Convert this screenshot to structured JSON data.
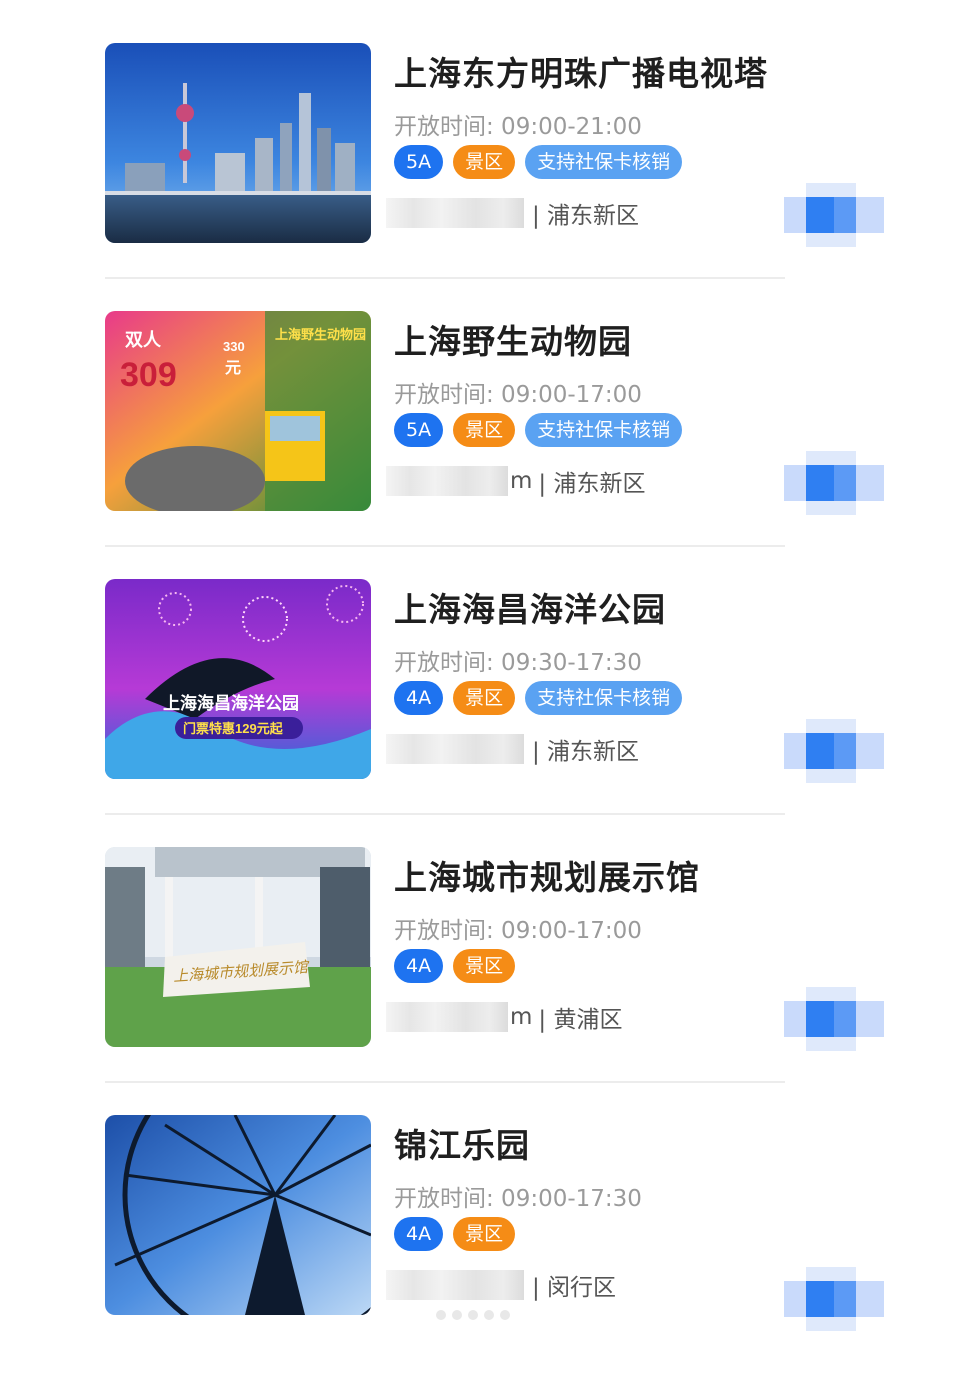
{
  "scenic_list": [
    {
      "name": "上海东方明珠广播电视塔",
      "hours": "开放时间: 09:00-21:00",
      "tags": {
        "level": "5A",
        "type": "景区",
        "social": "支持社保卡核销"
      },
      "distance_suffix": "",
      "district": "| 浦东新区",
      "image": "oriental-pearl-skyline"
    },
    {
      "name": "上海野生动物园",
      "hours": "开放时间: 09:00-17:00",
      "tags": {
        "level": "5A",
        "type": "景区",
        "social": "支持社保卡核销"
      },
      "distance_suffix": "m",
      "district": "| 浦东新区",
      "image": "wildlife-park-poster",
      "promo": {
        "label": "双人",
        "price": "309",
        "old_price": "330",
        "unit": "元",
        "brand": "上海野生动物园"
      }
    },
    {
      "name": "上海海昌海洋公园",
      "hours": "开放时间: 09:30-17:30",
      "tags": {
        "level": "4A",
        "type": "景区",
        "social": "支持社保卡核销"
      },
      "distance_suffix": "",
      "district": "| 浦东新区",
      "image": "ocean-park-poster",
      "promo": {
        "park": "上海海昌海洋公园",
        "deal": "门票特惠129元起"
      }
    },
    {
      "name": "上海城市规划展示馆",
      "hours": "开放时间: 09:00-17:00",
      "tags": {
        "level": "4A",
        "type": "景区",
        "social": ""
      },
      "distance_suffix": "m",
      "district": "| 黄浦区",
      "image": "planning-hall-building",
      "promo": {
        "sign": "上海城市规划展示馆"
      }
    },
    {
      "name": "锦江乐园",
      "hours": "开放时间: 09:00-17:30",
      "tags": {
        "level": "4A",
        "type": "景区",
        "social": ""
      },
      "distance_suffix": "",
      "district": "| 闵行区",
      "image": "ferris-wheel"
    }
  ],
  "colors": {
    "level_tag": "#1e73f0",
    "scenic_tag": "#f58c16",
    "social_tag": "#5aa2f2",
    "nav_button": "#2f7ff2"
  },
  "icons": {
    "row_action": "navigate-button-icon"
  }
}
